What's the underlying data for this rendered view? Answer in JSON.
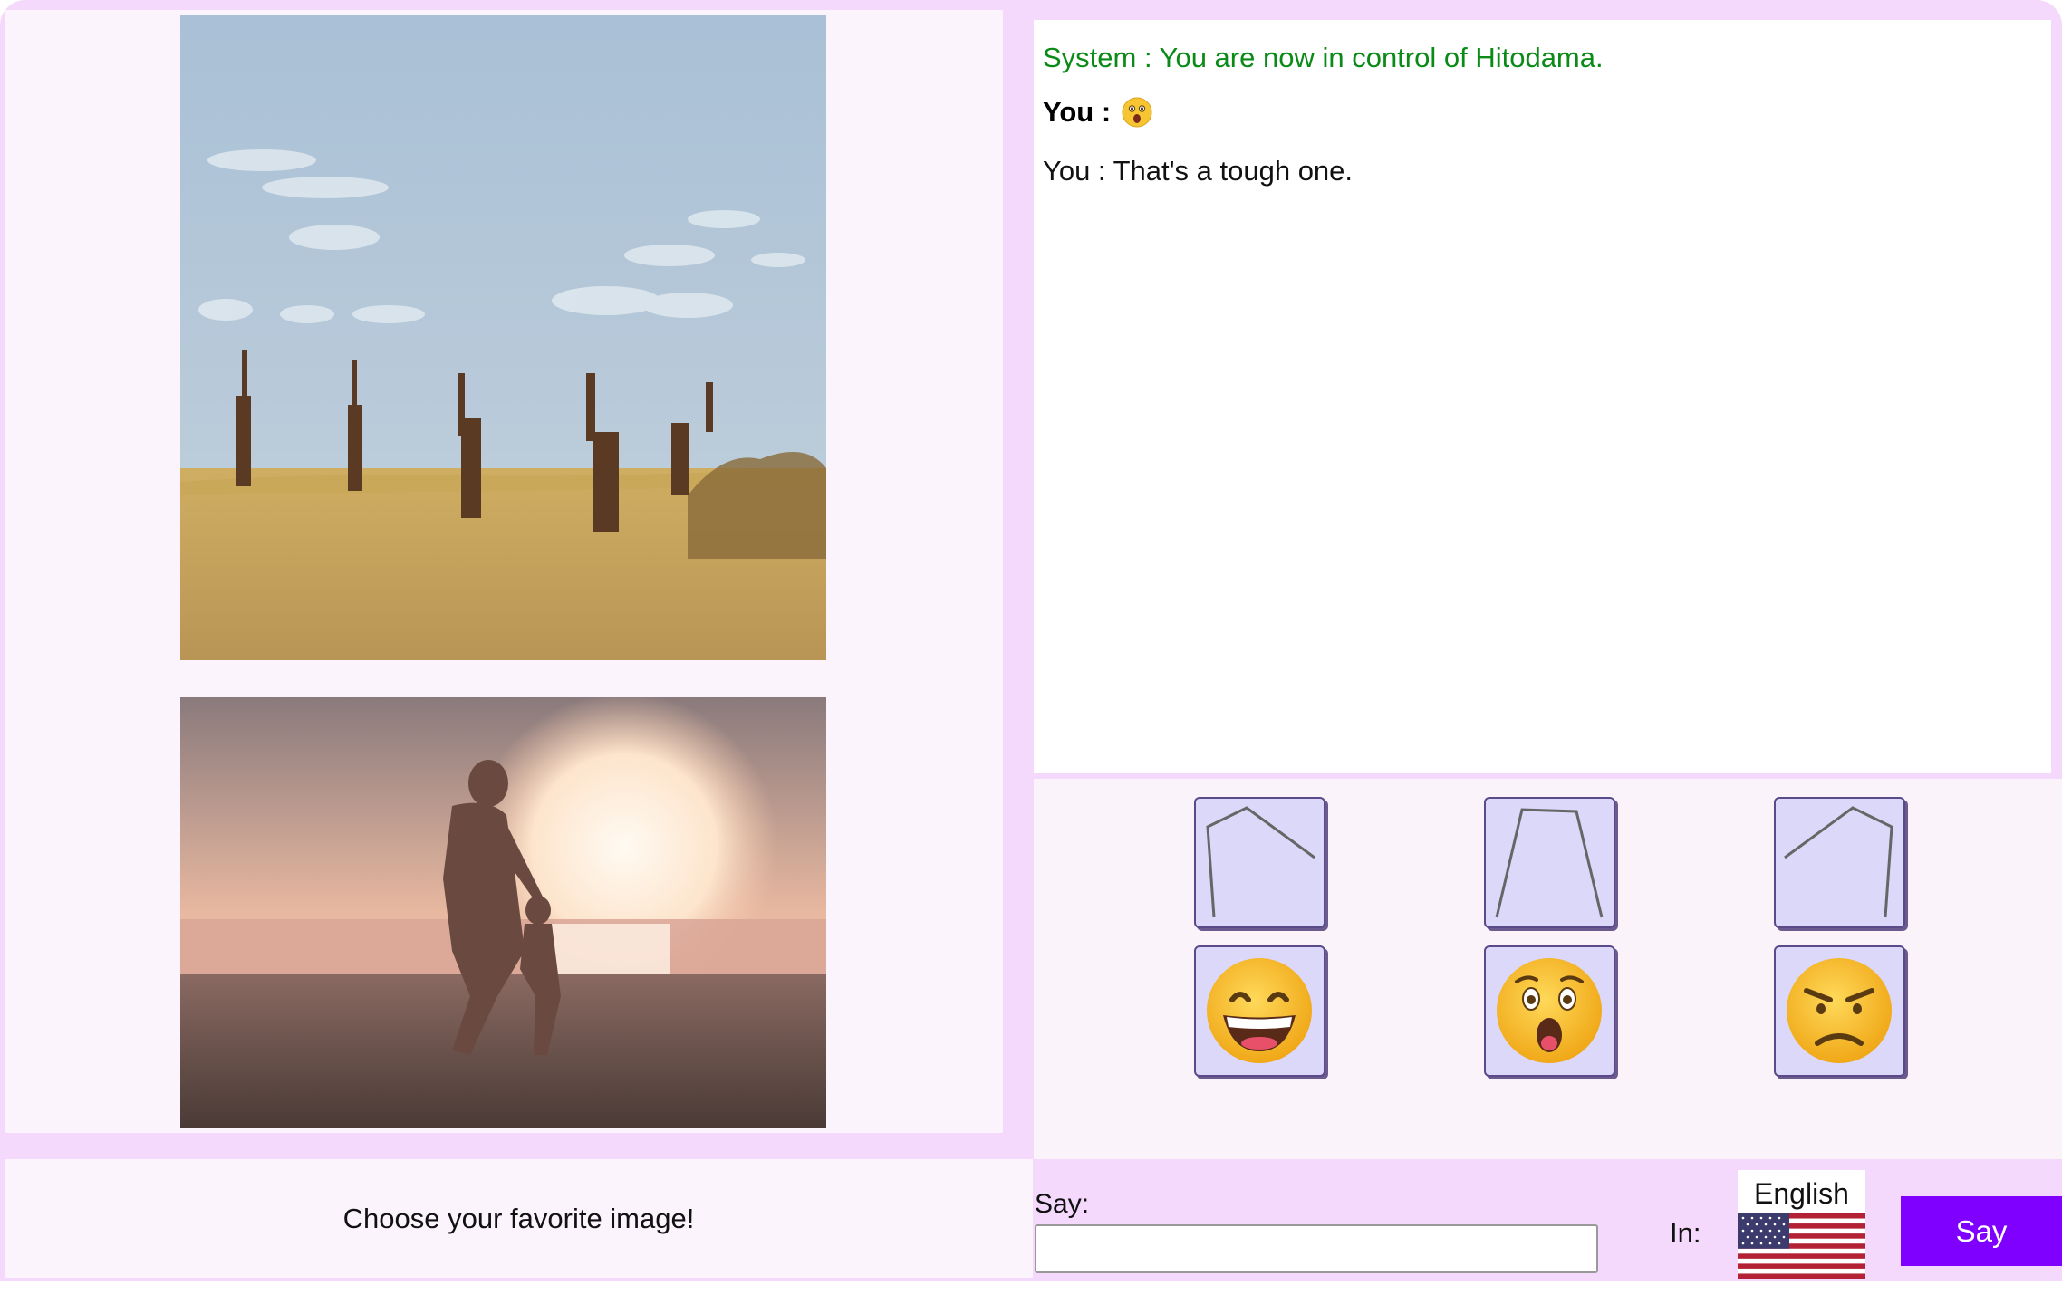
{
  "images": [
    {
      "name": "giraffes-savanna-photo"
    },
    {
      "name": "father-child-beach-sunset-photo"
    }
  ],
  "instruction": "Choose your favorite image!",
  "chat": {
    "line1": "System : You are now in control of Hitodama.",
    "line2_prefix": "You :",
    "line2_emoji": "astonished-face-emoji",
    "line3": "You : That's a tough one."
  },
  "expression_buttons": [
    {
      "icon": "mouth-shape-1-icon"
    },
    {
      "icon": "mouth-shape-2-icon"
    },
    {
      "icon": "mouth-shape-3-icon"
    },
    {
      "icon": "grinning-face-emoji"
    },
    {
      "icon": "astonished-face-emoji"
    },
    {
      "icon": "angry-face-emoji"
    }
  ],
  "say": {
    "label": "Say:",
    "value": "",
    "placeholder": "",
    "in_label": "In:",
    "language": "English",
    "flag": "us-flag-icon",
    "button_label": "Say"
  },
  "colors": {
    "system_text": "#0a8a16",
    "say_button": "#8000ff",
    "frame": "#f5d9fc",
    "button_bg": "#dcd8fa"
  }
}
